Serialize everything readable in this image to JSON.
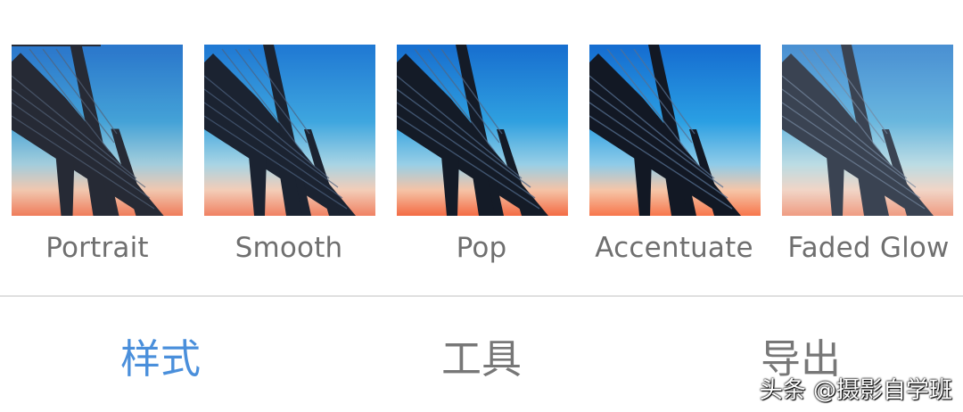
{
  "filters": [
    {
      "label": "Portrait",
      "tone": "portrait"
    },
    {
      "label": "Smooth",
      "tone": "smooth"
    },
    {
      "label": "Pop",
      "tone": "pop"
    },
    {
      "label": "Accentuate",
      "tone": "accentuate"
    },
    {
      "label": "Faded Glow",
      "tone": "faded"
    }
  ],
  "tabs": [
    {
      "label": "样式",
      "active": true
    },
    {
      "label": "工具",
      "active": false
    },
    {
      "label": "导出",
      "active": false
    }
  ],
  "watermark": "头条 @摄影自学班",
  "colors": {
    "active_tab": "#4a8fdb",
    "inactive_tab": "#777777",
    "label": "#6f6f6f",
    "divider": "#e0e0e0"
  }
}
